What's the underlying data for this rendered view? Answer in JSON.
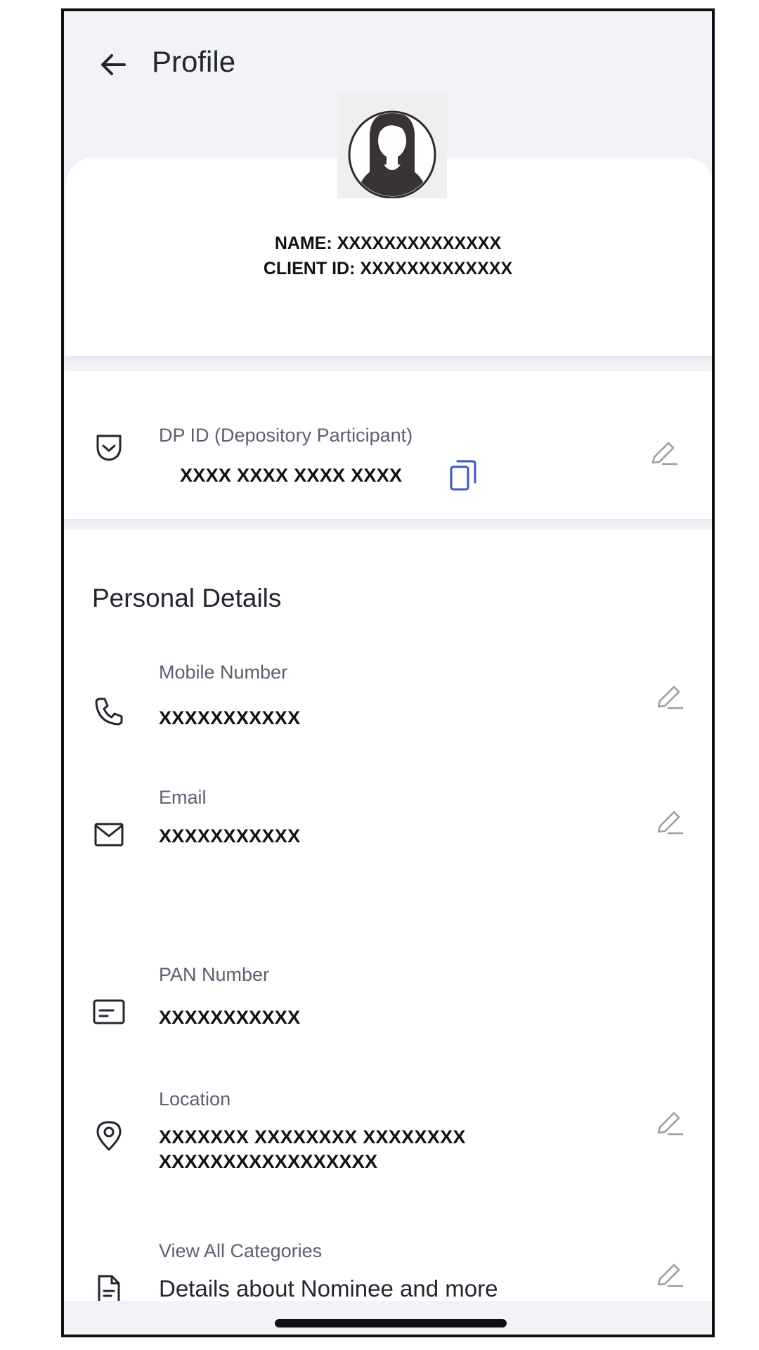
{
  "header": {
    "title": "Profile"
  },
  "profile": {
    "name_line": "NAME: XXXXXXXXXXXXXX",
    "client_id_line": "CLIENT ID: XXXXXXXXXXXXX"
  },
  "dp": {
    "label": "DP ID (Depository Participant)",
    "value": "XXXX XXXX XXXX XXXX"
  },
  "personal": {
    "title": "Personal Details",
    "fields": [
      {
        "label": "Mobile Number",
        "value": "XXXXXXXXXXX"
      },
      {
        "label": "Email",
        "value": "XXXXXXXXXXX"
      },
      {
        "label": "PAN Number",
        "value": "XXXXXXXXXXX"
      },
      {
        "label": "Location",
        "value_line1": "XXXXXXX XXXXXXXX XXXXXXXX",
        "value_line2": "XXXXXXXXXXXXXXXXX"
      },
      {
        "label": "View All Categories",
        "value": "Details about Nominee and more"
      }
    ]
  },
  "colors": {
    "accent": "#3b55c9",
    "background": "#f2f3f8",
    "card": "#ffffff"
  }
}
